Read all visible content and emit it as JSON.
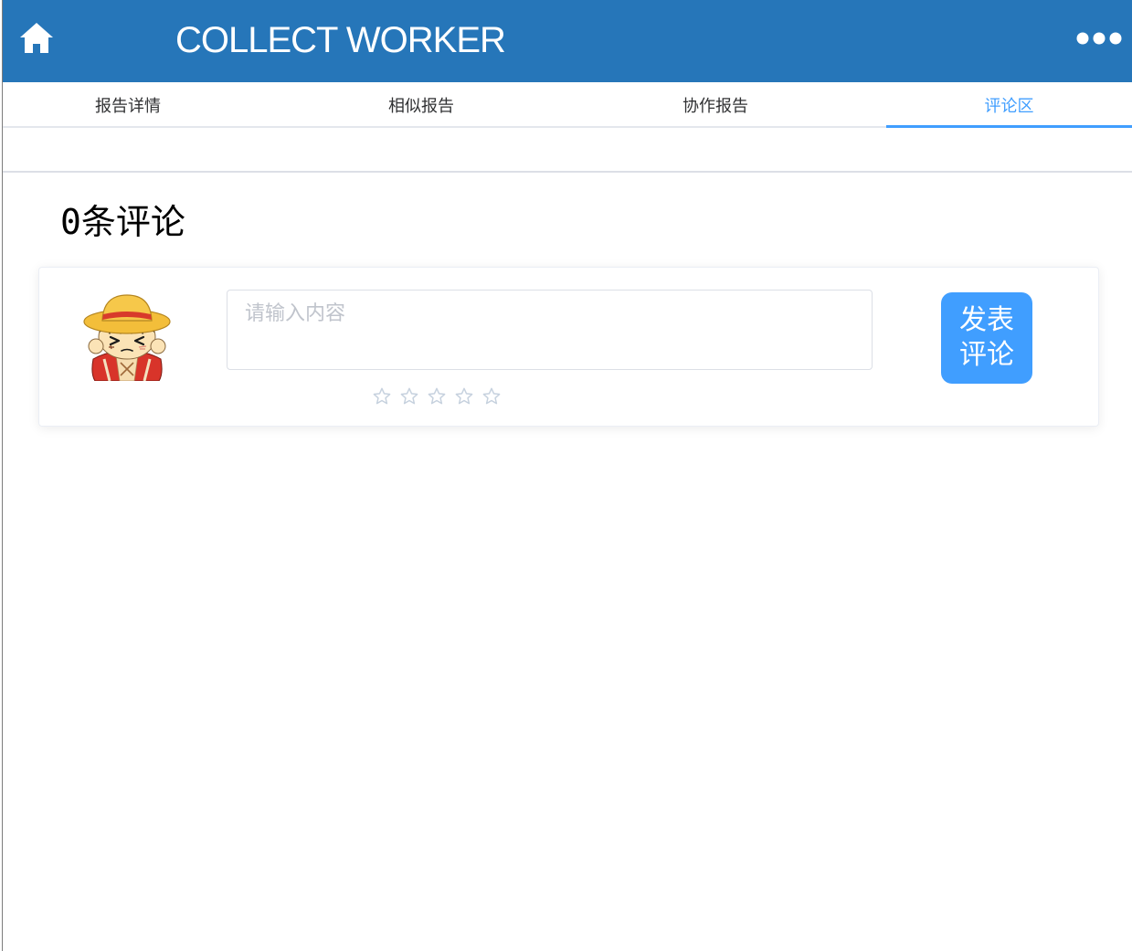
{
  "header": {
    "home_icon": "home-icon",
    "title": "COLLECT WORKER",
    "menu_icon": "more-dots-icon"
  },
  "tabs": [
    {
      "label": "报告详情",
      "active": false
    },
    {
      "label": "相似报告",
      "active": false
    },
    {
      "label": "协作报告",
      "active": false
    },
    {
      "label": "评论区",
      "active": true
    }
  ],
  "comments": {
    "count": "0",
    "count_suffix": "条评论"
  },
  "composer": {
    "avatar_icon": "cartoon-avatar",
    "input": {
      "value": "",
      "placeholder": "请输入内容"
    },
    "rating": {
      "value": 0,
      "max": 5,
      "icon": "star-outline-icon"
    },
    "submit_lines": [
      "发表",
      "评论"
    ]
  },
  "colors": {
    "header_bg": "#2676B9",
    "accent": "#409EFF",
    "tab_text": "#303133",
    "placeholder": "#C0C4CC",
    "star_void": "#C6D1DE",
    "divider": "#E4E7ED"
  }
}
